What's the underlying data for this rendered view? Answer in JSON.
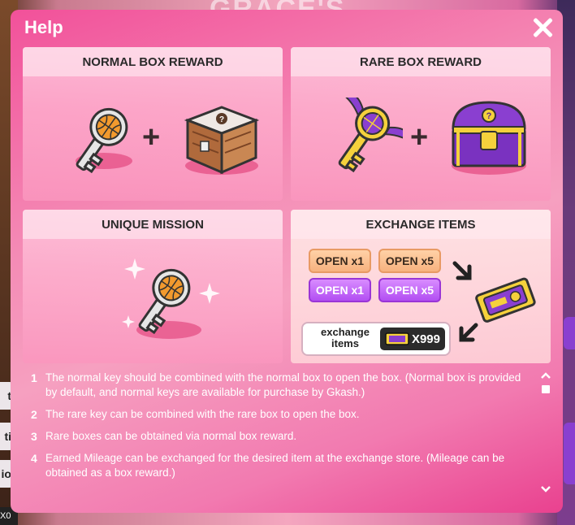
{
  "background": {
    "title_fragment": "GRACE'S",
    "left_tabs": [
      "t",
      "ti",
      "io"
    ],
    "corner_counter": "X0"
  },
  "dialog": {
    "title": "Help",
    "panels": {
      "normal": {
        "title": "NORMAL BOX REWARD",
        "plus": "+"
      },
      "rare": {
        "title": "RARE BOX REWARD",
        "plus": "+"
      },
      "unique": {
        "title": "UNIQUE MISSION"
      },
      "exchange": {
        "title": "EXCHANGE ITEMS",
        "buttons": [
          "OPEN x1",
          "OPEN x5",
          "OPEN x1",
          "OPEN x5"
        ],
        "exchange_label": "exchange items",
        "exchange_count": "X999"
      }
    },
    "notes": [
      {
        "num": "1",
        "text": "The normal key should be combined with the normal box to open the box. (Normal box is provided by default, and normal keys are available for purchase by Gkash.)"
      },
      {
        "num": "2",
        "text": "The rare key can be combined with the rare box to open the box."
      },
      {
        "num": "3",
        "text": "Rare boxes can be obtained via normal box reward."
      },
      {
        "num": "4",
        "text": "Earned Mileage can be exchanged for the desired item at the exchange store. (Mileage can be obtained as a box reward.)"
      }
    ]
  },
  "colors": {
    "dialog_pink": "#f27ab0",
    "orange_button": "#f7b27f",
    "purple_button": "#b24ef2"
  }
}
